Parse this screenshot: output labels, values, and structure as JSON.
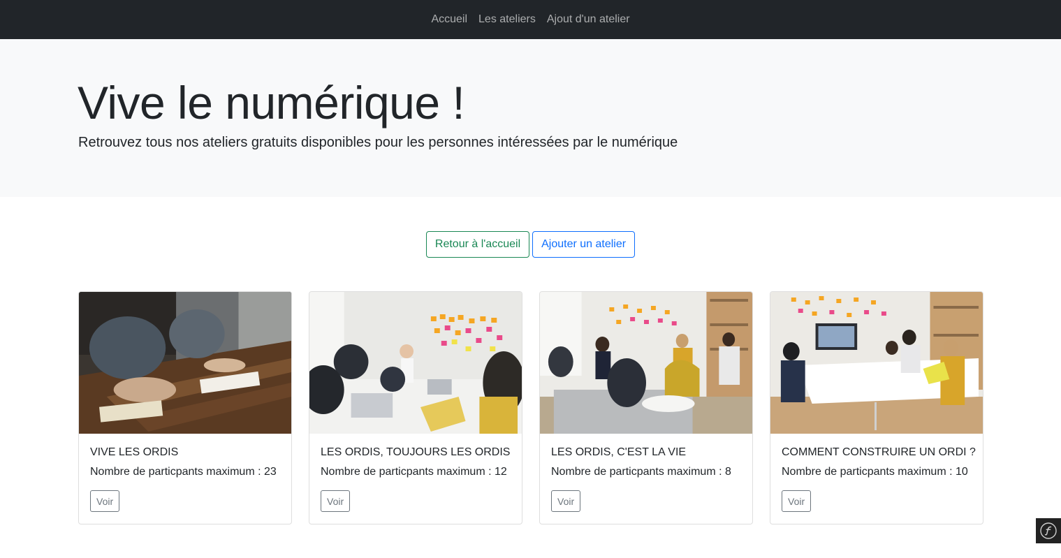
{
  "nav": {
    "links": [
      "Accueil",
      "Les ateliers",
      "Ajout d'un atelier"
    ]
  },
  "hero": {
    "title": "Vive le numérique !",
    "subtitle": "Retrouvez tous nos ateliers gratuits disponibles pour les personnes intéressées par le numérique"
  },
  "actions": {
    "home_label": "Retour à l'accueil",
    "add_label": "Ajouter un atelier"
  },
  "cards": [
    {
      "title": "VIVE LES ORDIS",
      "text": "Nombre de particpants maximum : 23",
      "button": "Voir"
    },
    {
      "title": "LES ORDIS, TOUJOURS LES ORDIS",
      "text": "Nombre de particpants maximum : 12",
      "button": "Voir"
    },
    {
      "title": "LES ORDIS, C'EST LA VIE",
      "text": "Nombre de particpants maximum : 8",
      "button": "Voir"
    },
    {
      "title": "COMMENT CONSTRUIRE UN ORDI ?",
      "text": "Nombre de particpants maximum : 10",
      "button": "Voir"
    }
  ],
  "colors": {
    "navbar_bg": "#212529",
    "jumbotron_bg": "#f8f9fa",
    "success": "#198754",
    "primary": "#0d6efd",
    "secondary": "#6c757d"
  },
  "toolbar": {
    "icon": "symfony-icon"
  }
}
